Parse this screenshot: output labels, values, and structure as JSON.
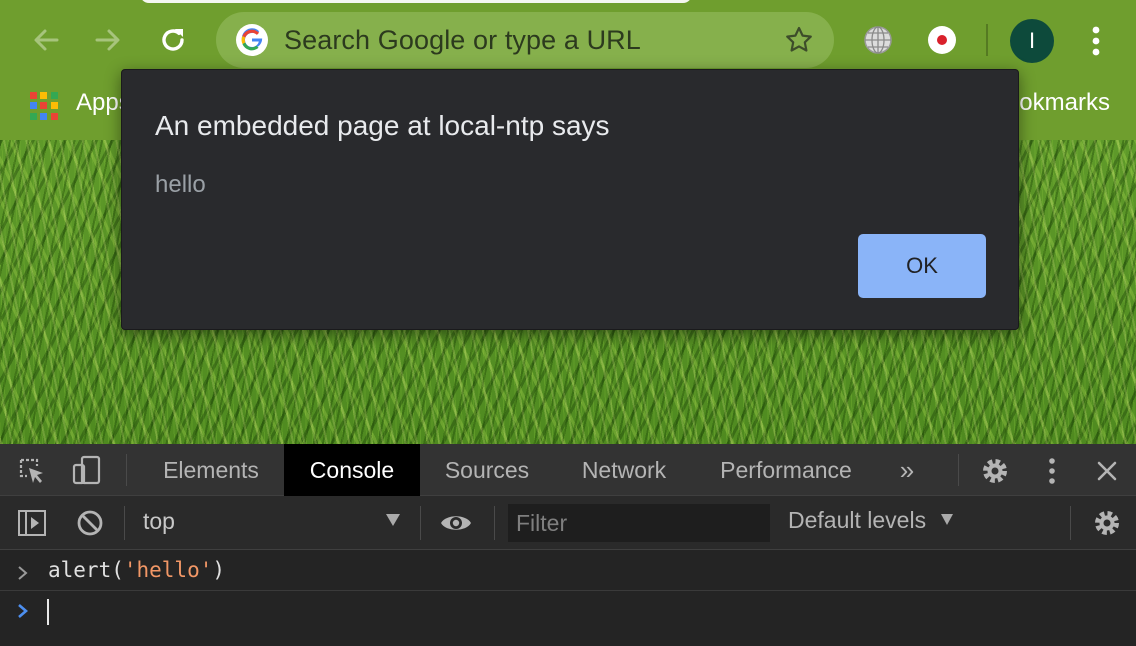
{
  "browser": {
    "omnibox_placeholder": "Search Google or type a URL",
    "avatar_initial": "I",
    "bookmarks": {
      "apps_label": "Apps",
      "bookmarks_label": "Bookmarks"
    }
  },
  "dialog": {
    "title": "An embedded page at local-ntp says",
    "message": "hello",
    "ok_label": "OK"
  },
  "devtools": {
    "tabs": [
      {
        "label": "Elements",
        "active": false
      },
      {
        "label": "Console",
        "active": true
      },
      {
        "label": "Sources",
        "active": false
      },
      {
        "label": "Network",
        "active": false
      },
      {
        "label": "Performance",
        "active": false
      }
    ],
    "more_tabs": "»",
    "console_toolbar": {
      "context": "top",
      "filter_placeholder": "Filter",
      "levels": "Default levels"
    },
    "console": {
      "entry_fn": "alert(",
      "entry_arg": "'hello'",
      "entry_close": ")"
    }
  },
  "colors": {
    "chrome_bg": "#6f9e2e",
    "dialog_bg": "#292a2d",
    "ok_button": "#8ab4f8",
    "string_literal": "#f29766",
    "active_tab_bg": "#000000"
  }
}
